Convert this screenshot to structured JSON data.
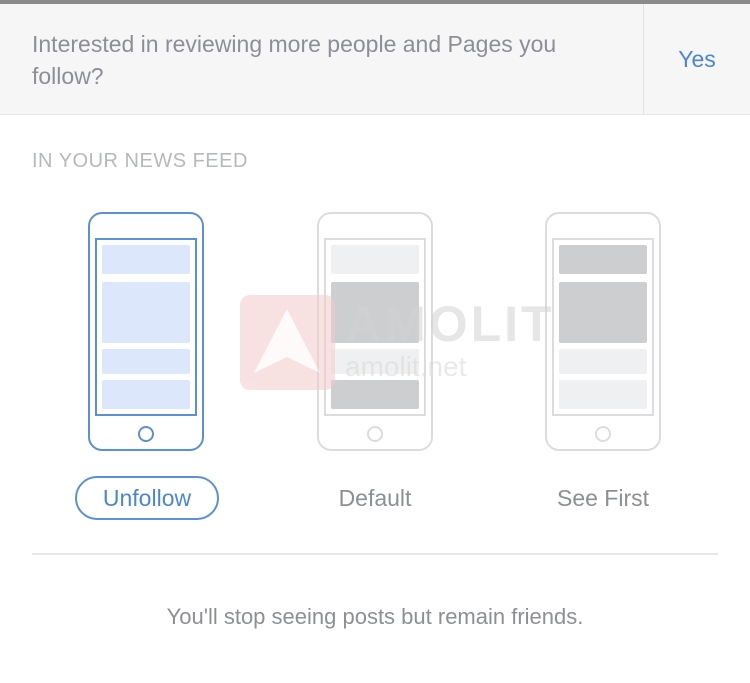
{
  "prompt": {
    "text": "Interested in reviewing more people and Pages you follow?",
    "yes_label": "Yes"
  },
  "section": {
    "header": "IN YOUR NEWS FEED"
  },
  "options": [
    {
      "label": "Unfollow",
      "selected": true
    },
    {
      "label": "Default",
      "selected": false
    },
    {
      "label": "See First",
      "selected": false
    }
  ],
  "description": "You'll stop seeing posts but remain friends.",
  "watermark": {
    "brand": "AMOLIT",
    "site": "amolit.net"
  },
  "colors": {
    "accent": "#4a86d8",
    "muted_text": "#8c8f94",
    "header_text": "#b6b8bc"
  }
}
